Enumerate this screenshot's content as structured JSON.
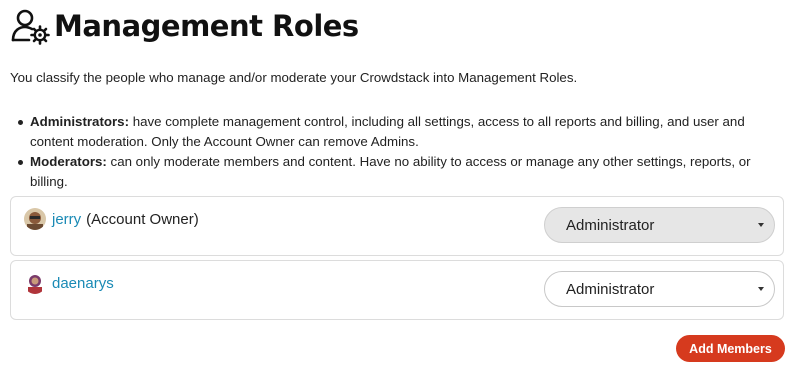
{
  "header": {
    "title": "Management Roles",
    "icon": "user-gear-icon"
  },
  "intro": "You classify the people who manage and/or moderate your Crowdstack into Management Roles.",
  "roles": [
    {
      "name": "Administrators:",
      "description": "have complete management control, including all settings, access to all reports and billing, and user and content moderation. Only the Account Owner can remove Admins."
    },
    {
      "name": "Moderators:",
      "description": "can only moderate members and content. Have no ability to access or manage any other settings, reports, or billing."
    }
  ],
  "members": [
    {
      "name": "jerry",
      "tag": "(Account Owner)",
      "role": "Administrator",
      "role_disabled": true,
      "avatar": "avatar-photo-icon"
    },
    {
      "name": "daenarys",
      "tag": "",
      "role": "Administrator",
      "role_disabled": false,
      "avatar": "avatar-photo-icon"
    }
  ],
  "actions": {
    "add_members": "Add Members"
  },
  "colors": {
    "link": "#1a8ab5",
    "accent": "#d63a1e",
    "disabled_select": "#e6e6e6"
  }
}
